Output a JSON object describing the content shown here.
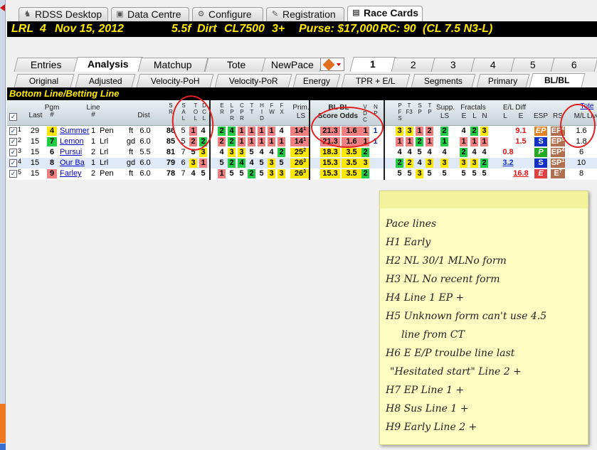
{
  "main_tabs": [
    {
      "label": "RDSS Desktop",
      "icon": "horse-icon"
    },
    {
      "label": "Data Centre",
      "icon": "database-icon"
    },
    {
      "label": "Configure",
      "icon": "gear-icon"
    },
    {
      "label": "Registration",
      "icon": "registration-icon"
    },
    {
      "label": "Race Cards",
      "icon": "card-icon",
      "active": true
    }
  ],
  "race_header": {
    "track": "LRL",
    "race": "4",
    "date": "Nov 15, 2012",
    "distance": "5.5f",
    "surface": "Dirt",
    "class": "CL7500",
    "age": "3+",
    "purse": "Purse: $17,000",
    "rc": "RC: 90",
    "rc_detail": "(CL 7.5 N3-L)"
  },
  "view_tabs": [
    "Entries",
    "Analysis",
    "Matchup",
    "Tote",
    "NewPace"
  ],
  "active_view_tab": "Analysis",
  "race_number_tabs": [
    "1",
    "2",
    "3",
    "4",
    "5",
    "6"
  ],
  "active_race_tab": "1",
  "sub_tabs": [
    "Original",
    "Adjusted",
    "Velocity-PoH",
    "Velocity-PoR",
    "Energy",
    "TPR + E/L",
    "Segments",
    "Primary",
    "BL/BL"
  ],
  "active_sub_tab": "BL/BL",
  "section_title": "Bottom Line/Betting Line",
  "columns": {
    "last": "Last",
    "pgm": "Pgm",
    "pgm2": "#",
    "line": "Line",
    "line2": "#",
    "dist": "Dist",
    "sr": "S R",
    "stat1": "S A L",
    "stat2": "T O L",
    "stat3": "D C L",
    "stat4": "D I F",
    "pace1": "E R",
    "pace2": "L P R",
    "pace3": "C P R",
    "pace4": "T T",
    "pace5": "H I D",
    "pace6": "F W",
    "pace7": "F X",
    "prim": "Prim.",
    "prim2": "LS",
    "blbl": "BL BL",
    "score_odds": "Score Odds",
    "vdc": "V D C",
    "np": "N P",
    "ptsp1": "P F S",
    "ptsp2": "T F3",
    "ptsp3": "S P",
    "ptsp4": "T P",
    "supp": "Supp.",
    "supp2": "LS",
    "fractals": "Fractals",
    "frac_e": "E",
    "frac_l": "L",
    "frac_n": "N",
    "eldiff": "E/L Diff",
    "el_l": "L",
    "el_e": "E",
    "esp": "ESP",
    "rs": "RS",
    "tote": "Tote",
    "ml": "M/L",
    "live": "Live"
  },
  "entries": [
    {
      "n": "1",
      "last": "29",
      "pgm": "4",
      "pgm_color": "y",
      "horse": "Summer",
      "line": "1",
      "track": "Pen",
      "cond": "ft",
      "dist": "6.0",
      "sr": "86",
      "s1": "5",
      "s2": "1",
      "s3": "4",
      "pace": [
        [
          "2",
          "g"
        ],
        [
          "4",
          "g"
        ],
        [
          "1",
          "r"
        ],
        [
          "1",
          "r"
        ],
        [
          "1",
          "r"
        ],
        [
          "1",
          "r"
        ],
        [
          "4",
          ""
        ]
      ],
      "prim": "14",
      "prim_sup": "1",
      "score": "21.3",
      "odds": "1.6",
      "v": "1",
      "v_c": "r",
      "np": "1",
      "p": [
        [
          "3",
          "y"
        ],
        [
          "3",
          "y"
        ],
        [
          "1",
          "r"
        ],
        [
          "2",
          "r"
        ]
      ],
      "supp": "2",
      "fr": [
        [
          "4",
          ""
        ],
        [
          "2",
          "g"
        ],
        [
          "3",
          "y"
        ]
      ],
      "el_l": "",
      "el_e": "9.1",
      "esp": "EP",
      "esp_c": "orn",
      "rs": "EP",
      "rs_sup": "4",
      "ml": "1.6"
    },
    {
      "n": "2",
      "last": "15",
      "pgm": "7",
      "pgm_color": "g",
      "horse": "Lemon",
      "line": "1",
      "track": "Lrl",
      "cond": "gd",
      "dist": "6.0",
      "sr": "85",
      "s1": "5",
      "s2": "2",
      "s3": "2",
      "pace": [
        [
          "2",
          "r"
        ],
        [
          "2",
          "g"
        ],
        [
          "1",
          "r"
        ],
        [
          "1",
          "r"
        ],
        [
          "1",
          "r"
        ],
        [
          "1",
          "r"
        ],
        [
          "1",
          "r"
        ]
      ],
      "prim": "14",
      "prim_sup": "1",
      "score": "21.3",
      "odds": "1.6",
      "v": "1",
      "v_c": "r",
      "np": "1",
      "p": [
        [
          "1",
          "r"
        ],
        [
          "1",
          "r"
        ],
        [
          "2",
          "g"
        ],
        [
          "1",
          "r"
        ]
      ],
      "supp": "1",
      "fr": [
        [
          "1",
          "r"
        ],
        [
          "1",
          "r"
        ],
        [
          "1",
          "r"
        ]
      ],
      "el_l": "",
      "el_e": "1.5",
      "esp": "S",
      "esp_c": "b",
      "rs": "EP",
      "rs_sup": "5",
      "ml": "1.8"
    },
    {
      "n": "3",
      "last": "15",
      "pgm": "6",
      "pgm_color": "",
      "horse": "Pursui",
      "line": "2",
      "track": "Lrl",
      "cond": "ft",
      "dist": "5.5",
      "sr": "81",
      "s1": "7",
      "s2": "5",
      "s3": "3",
      "pace": [
        [
          "4",
          ""
        ],
        [
          "3",
          "y"
        ],
        [
          "3",
          "y"
        ],
        [
          "5",
          ""
        ],
        [
          "4",
          ""
        ],
        [
          "4",
          ""
        ],
        [
          "2",
          "g"
        ]
      ],
      "prim": "25",
      "prim_sup": "2",
      "score": "18.3",
      "odds": "3.5",
      "v": "2",
      "v_c": "g",
      "np": "",
      "p": [
        [
          "4",
          ""
        ],
        [
          "4",
          ""
        ],
        [
          "5",
          ""
        ],
        [
          "4",
          ""
        ]
      ],
      "supp": "4",
      "fr": [
        [
          "2",
          "g"
        ],
        [
          "4",
          ""
        ],
        [
          "4",
          ""
        ]
      ],
      "el_l": "0.8",
      "el_e": "",
      "esp": "P",
      "esp_c": "gr",
      "rs": "EP",
      "rs_sup": "4",
      "ml": "6"
    },
    {
      "n": "4",
      "last": "15",
      "pgm": "8",
      "pgm_color": "",
      "horse": "Our Ba",
      "line": "1",
      "track": "Lrl",
      "cond": "gd",
      "dist": "6.0",
      "sr": "79",
      "s1": "6",
      "s2": "3",
      "s3": "1",
      "pace": [
        [
          "5",
          ""
        ],
        [
          "2",
          "g"
        ],
        [
          "4",
          "g"
        ],
        [
          "4",
          ""
        ],
        [
          "5",
          ""
        ],
        [
          "3",
          "y"
        ],
        [
          "5",
          ""
        ]
      ],
      "prim": "26",
      "prim_sup": "3",
      "score": "15.3",
      "odds": "3.5",
      "v": "3",
      "v_c": "y",
      "np": "",
      "p": [
        [
          "2",
          "g"
        ],
        [
          "2",
          "y"
        ],
        [
          "4",
          ""
        ],
        [
          "3",
          "y"
        ]
      ],
      "supp": "3",
      "fr": [
        [
          "3",
          "y"
        ],
        [
          "3",
          "y"
        ],
        [
          "2",
          "g"
        ]
      ],
      "el_l": "3.2",
      "el_e": "",
      "esp": "S",
      "esp_c": "b",
      "rs": "SP",
      "rs_sup": "1",
      "ml": "10"
    },
    {
      "n": "5",
      "last": "15",
      "pgm": "9",
      "pgm_color": "r",
      "horse": "Farley",
      "line": "2",
      "track": "Pen",
      "cond": "ft",
      "dist": "6.0",
      "sr": "78",
      "s1": "7",
      "s2": "4",
      "s3": "5",
      "pace": [
        [
          "1",
          "r"
        ],
        [
          "5",
          ""
        ],
        [
          "5",
          ""
        ],
        [
          "2",
          "g"
        ],
        [
          "5",
          ""
        ],
        [
          "3",
          "y"
        ],
        [
          "3",
          "y"
        ]
      ],
      "prim": "26",
      "prim_sup": "3",
      "score": "15.3",
      "odds": "3.5",
      "v": "2",
      "v_c": "g",
      "np": "",
      "p": [
        [
          "5",
          ""
        ],
        [
          "5",
          ""
        ],
        [
          "3",
          "y"
        ],
        [
          "5",
          ""
        ]
      ],
      "supp": "5",
      "fr": [
        [
          "5",
          ""
        ],
        [
          "5",
          ""
        ],
        [
          "5",
          ""
        ]
      ],
      "el_l": "",
      "el_e": "16.8",
      "esp": "E",
      "esp_c": "dred",
      "rs": "E",
      "rs_sup": "7",
      "ml": "8"
    }
  ],
  "sticky_note": {
    "lines": [
      "Pace lines",
      "H1  Early",
      "H2  NL 30/1 MLNo form",
      "H3  NL No recent form",
      "H4  Line 1 EP +",
      "H5  Unknown form can't use 4.5",
      "line from CT",
      "H6  E E/P  troulbe line last",
      "\"Hesitated start\" Line 2 +",
      "H7  EP Line 1 +",
      "H8  Sus Line 1 +",
      "H9  Early Line 2 +"
    ]
  },
  "colors": {
    "header_bg": "#000000",
    "header_fg": "#ffe800",
    "highlight_circle": "#e02020",
    "note_bg": "#fdfdc2"
  }
}
